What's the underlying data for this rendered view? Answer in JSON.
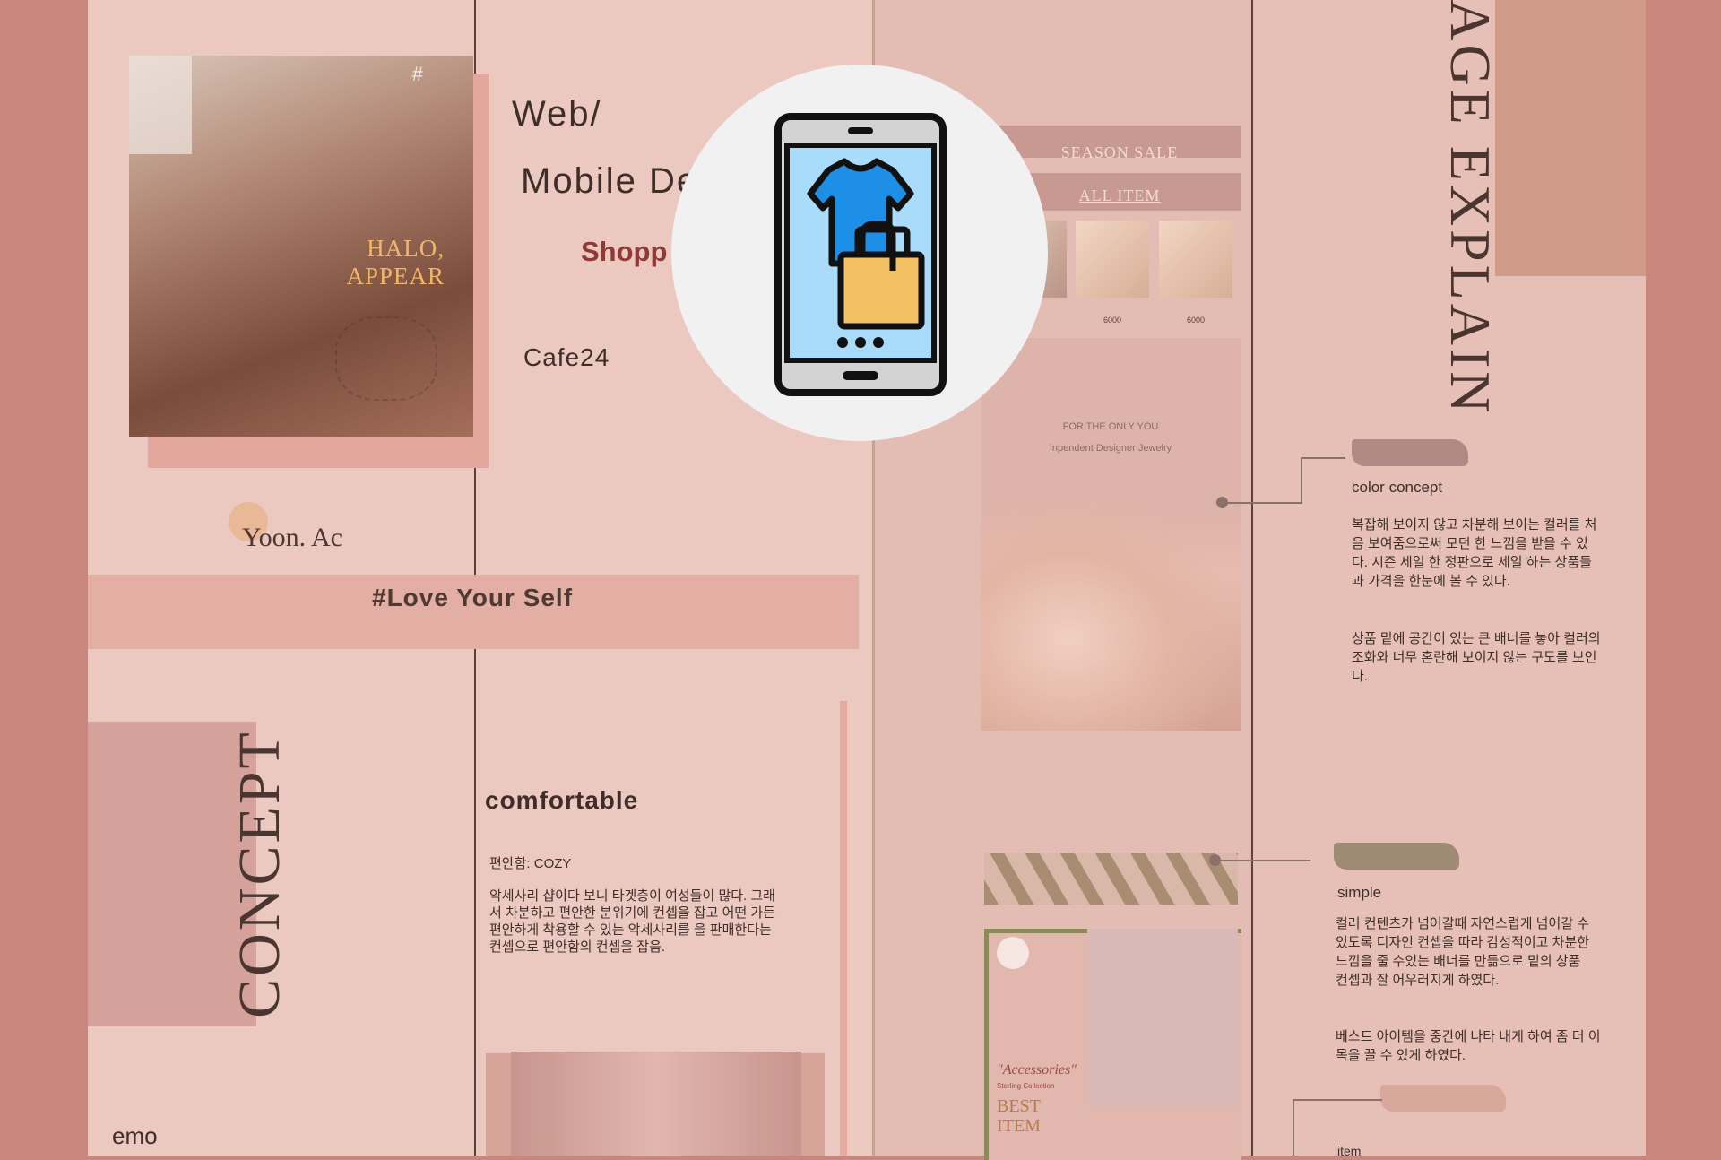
{
  "left_panel": {
    "photo_text_line1": "HALO,",
    "photo_text_line2": "APPEAR",
    "photo_hash": "#",
    "signature": "Yoon. Ac",
    "hashtag_strip": "#Love Your Self",
    "concept_title": "CONCEPT",
    "emo_label": "emo"
  },
  "center_panel": {
    "title_line1": "Web/",
    "title_line2": "Mobile Des",
    "subtitle": "Shopp",
    "platform": "Cafe24",
    "comfortable_heading": "comfortable",
    "cozy_line": "편안함: COZY",
    "comfortable_body": "악세사리 샵이다 보니 타겟층이 여성들이 많다. 그래서 차분하고 편안한 분위기에 컨셉을 잡고 어떤 가든 편안하게 착용할 수 있는 악세사리를 을 판매한다는 컨셉으로 편안함의 컨셉을 잡음."
  },
  "mock_site": {
    "season_sale": "SEASON SALE",
    "all_item": "ALL ITEM",
    "prices": [
      "6000",
      "6000"
    ],
    "hero_line1": "FOR THE ONLY YOU",
    "hero_line2": "Inpendent Designer Jewelry",
    "accessories_script": "\"Accessories\"",
    "accessories_sub": "Sterling Collection",
    "best_item": "BEST ITEM"
  },
  "right_panel": {
    "page_explain": "PAGE EXPLAIN",
    "color_concept_label": "color concept",
    "color_concept_body1": "복잡해 보이지 않고 차분해 보이는 컬러를 처음 보여줌으로써 모던 한 느낌을 받을 수 있다. 시즌 세일 한 정판으로 세일 하는 상품들과 가격을 한눈에 볼 수 있다.",
    "color_concept_body2": "상품 밑에 공간이 있는 큰 배너를 놓아 컬러의 조화와 너무 혼란해 보이지 않는 구도를 보인다.",
    "simple_label": "simple",
    "simple_body1": "컬러 컨텐츠가 넘어갈때 자연스럽게 넘어갈 수 있도록 디자인 컨셉을 따라 감성적이고 차분한 느낌을 줄 수있는 배너를 만듦으로 밑의 상품 컨셉과 잘 어우러지게 하였다.",
    "simple_body2": "베스트 아이템을 중간에 나타 내게 하여 좀 더 이목을 끌 수 있게 하였다.",
    "item_label": "item"
  },
  "icon": {
    "name": "mobile-shopping-icon",
    "colors": {
      "circle": "#f1f1f1",
      "screen": "#a9dcfb",
      "shirt": "#1d8fe6",
      "bag": "#f2c164",
      "frame": "#d3d3d3",
      "outline": "#111111"
    }
  }
}
